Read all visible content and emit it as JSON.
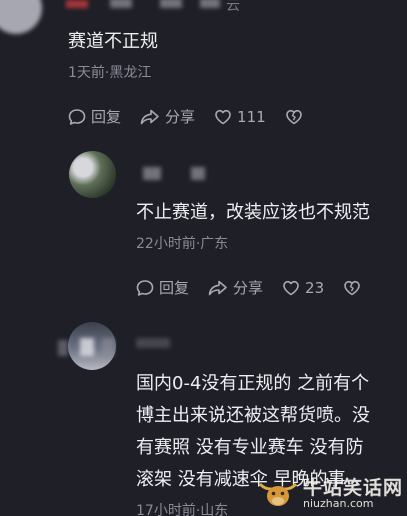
{
  "comment1": {
    "username_suffix": "云",
    "text": "赛道不正规",
    "meta": "1天前·黑龙江",
    "actions": {
      "reply": "回复",
      "share": "分享",
      "likes": "111"
    }
  },
  "comment2": {
    "text": "不止赛道，改装应该也不规范",
    "meta": "22小时前·广东",
    "actions": {
      "reply": "回复",
      "share": "分享",
      "likes": "23"
    }
  },
  "comment3": {
    "lines": [
      "国内0-4没有正规的 之前有个",
      "博主出来说还被这帮货喷。没",
      "有赛照 没有专业赛车 没有防",
      "滚架 没有减速伞 早晚的事"
    ],
    "meta": "17小时前·山东"
  },
  "watermark": {
    "title": "牛站笑话网",
    "url": "niuzhan.com"
  },
  "colors": {
    "background": "#1f1f28",
    "text": "#eeeef2",
    "meta": "#8b8b96",
    "actions": "#a9a9b4"
  }
}
